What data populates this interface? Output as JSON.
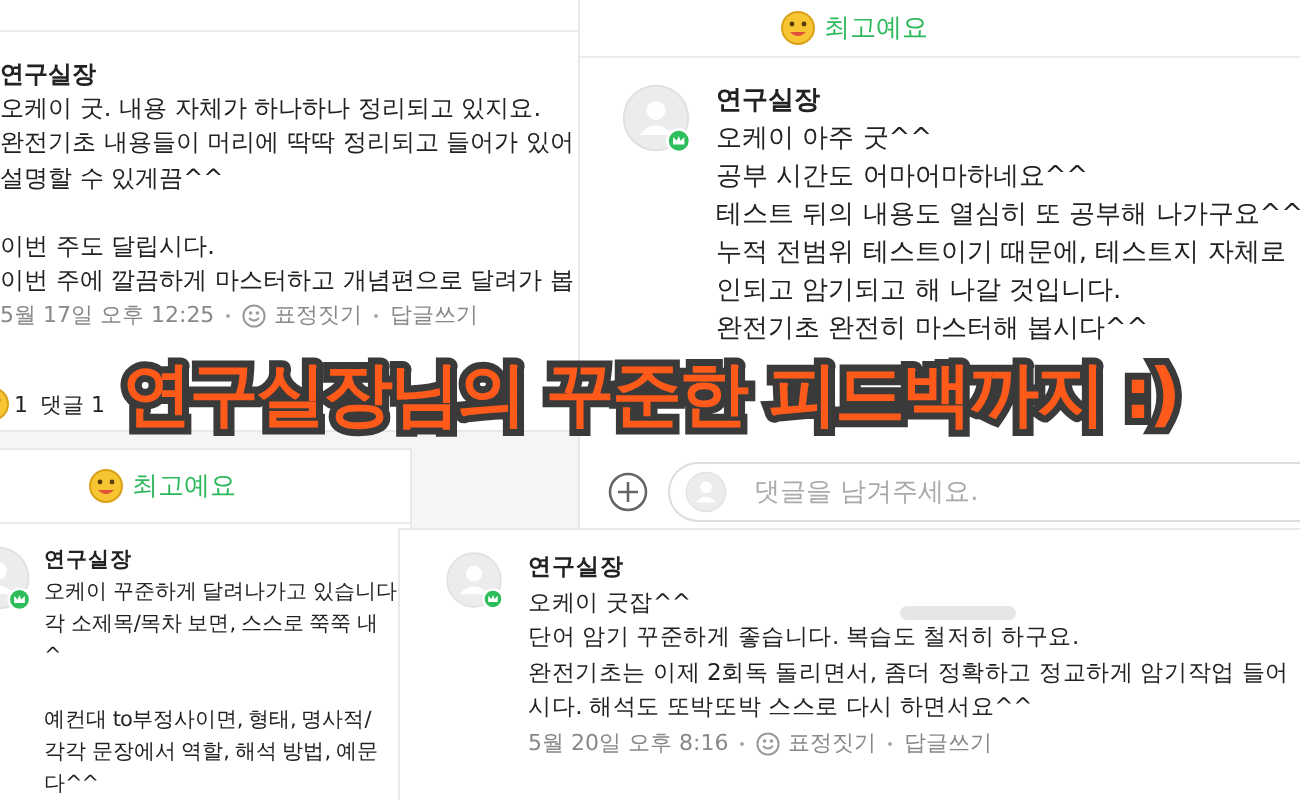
{
  "panels": [
    {
      "parts": [
        {
          "kind": "comment",
          "avatar": false,
          "author": "연구실장",
          "paragraphs": [
            [
              "오케이 굿. 내용 자체가 하나하나 정리되고 있지요.",
              "완전기초 내용들이 머리에 딱딱 정리되고 들어가 있어",
              "설명할 수 있게끔^^"
            ],
            [
              "이번 주도 달립시다.",
              "이번 주에 깔끔하게 마스터하고 개념편으로 달려가 봅"
            ]
          ],
          "meta": {
            "time": "5월 17일 오후 12:25",
            "actions": [
              "표정짓기",
              "답글쓰기"
            ]
          }
        },
        {
          "kind": "stats",
          "likes": "1",
          "comments": "댓글 1"
        }
      ]
    },
    {
      "parts": [
        {
          "kind": "reaction",
          "label": "최고예요"
        },
        {
          "kind": "comment",
          "avatar": true,
          "author": "연구실장",
          "paragraphs": [
            [
              "오케이 아주 굿^^",
              "공부 시간도 어마어마하네요^^",
              "테스트 뒤의 내용도 열심히 또 공부해 나가구요^^",
              "누적 전범위 테스트이기 때문에, 테스트지 자체로",
              "인되고 암기되고 해 나갈 것입니다.",
              "완전기초 완전히 마스터해 봅시다^^"
            ]
          ]
        },
        {
          "kind": "input",
          "placeholder": "댓글을 남겨주세요."
        }
      ]
    },
    {
      "parts": [
        {
          "kind": "reaction",
          "label": "최고예요"
        },
        {
          "kind": "comment",
          "avatar": true,
          "author": "연구실장",
          "paragraphs": [
            [
              "오케이 꾸준하게 달려나가고 있습니다",
              "각 소제목/목차 보면, 스스로 쭉쭉 내",
              "^"
            ],
            [
              "예컨대 to부정사이면, 형태, 명사적/",
              "각각 문장에서 역할, 해석 방법, 예문",
              "다^^"
            ]
          ]
        }
      ]
    },
    {
      "parts": [
        {
          "kind": "comment",
          "avatar": true,
          "author": "연구실장",
          "paragraphs": [
            [
              "오케이 굿잡^^",
              "단어 암기 꾸준하게 좋습니다. 복습도 철저히 하구요.",
              "완전기초는 이제 2회독 돌리면서, 좀더 정확하고 정교하게 암기작업 들어",
              "시다. 해석도 또박또박 스스로 다시 하면서요^^"
            ]
          ],
          "meta": {
            "time": "5월 20일 오후 8:16",
            "actions": [
              "표정짓기",
              "답글쓰기"
            ]
          }
        }
      ]
    }
  ],
  "banner": {
    "text": "연구실장님의 꾸준한 피드백까지 :)"
  }
}
